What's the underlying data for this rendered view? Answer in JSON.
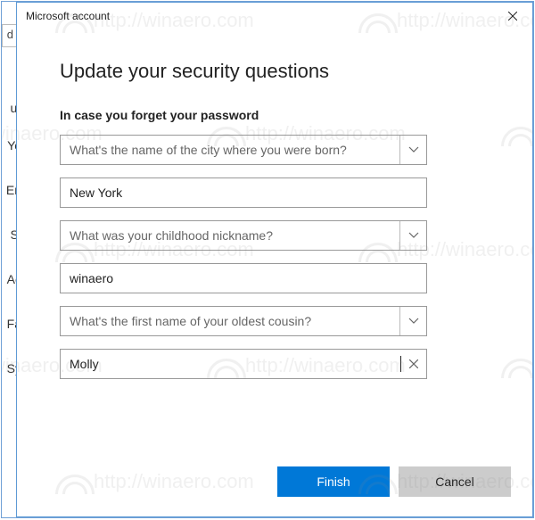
{
  "dialog": {
    "window_title": "Microsoft account",
    "heading": "Update your security questions",
    "subheading": "In case you forget your password",
    "questions": [
      {
        "prompt": "What's the name of the city where you were born?",
        "answer": "New York"
      },
      {
        "prompt": "What was your childhood nickname?",
        "answer": "winaero"
      },
      {
        "prompt": "What's the first name of your oldest cousin?",
        "answer": "Molly"
      }
    ],
    "buttons": {
      "finish": "Finish",
      "cancel": "Cancel"
    }
  },
  "background_fragments": {
    "top": "d",
    "items": [
      "ur",
      "Yo",
      "En",
      "Si",
      "Ac",
      "Fa",
      "Sy"
    ]
  },
  "watermark": {
    "text": "http://winaero.com"
  },
  "colors": {
    "accent": "#0078d7",
    "border": "#5e9ad5",
    "muted_text": "#666"
  }
}
